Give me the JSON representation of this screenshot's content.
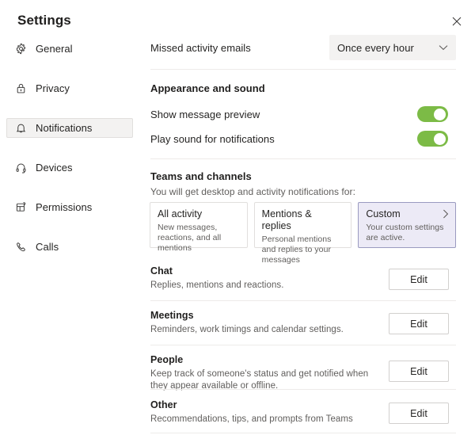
{
  "dialog": {
    "title": "Settings",
    "close_label": "Close"
  },
  "sidebar": {
    "items": [
      {
        "label": "General",
        "icon": "gear-icon",
        "selected": false
      },
      {
        "label": "Privacy",
        "icon": "lock-icon",
        "selected": false
      },
      {
        "label": "Notifications",
        "icon": "bell-icon",
        "selected": true
      },
      {
        "label": "Devices",
        "icon": "headset-icon",
        "selected": false
      },
      {
        "label": "Permissions",
        "icon": "app-grid-icon",
        "selected": false
      },
      {
        "label": "Calls",
        "icon": "phone-icon",
        "selected": false
      }
    ]
  },
  "main": {
    "missed_activity": {
      "label": "Missed activity emails",
      "dropdown_value": "Once every hour",
      "dropdown_icon": "chevron-down-icon"
    },
    "appearance": {
      "heading": "Appearance and sound",
      "toggles": [
        {
          "label": "Show message preview",
          "state": "on"
        },
        {
          "label": "Play sound for notifications",
          "state": "on"
        }
      ]
    },
    "teams_and_channels": {
      "heading": "Teams and channels",
      "subtext": "You will get desktop and activity notifications for:",
      "cards": [
        {
          "title": "All activity",
          "desc": "New messages, reactions, and all mentions",
          "selected": false,
          "chevron": ""
        },
        {
          "title": "Mentions & replies",
          "desc": "Personal mentions and replies to your messages",
          "selected": false,
          "chevron": ""
        },
        {
          "title": "Custom",
          "desc": "Your custom settings are active.",
          "selected": true,
          "chevron": "chevron-right-icon"
        }
      ]
    },
    "edit_sections": [
      {
        "title": "Chat",
        "desc": "Replies, mentions and reactions.",
        "button": "Edit"
      },
      {
        "title": "Meetings",
        "desc": "Reminders, work timings and calendar settings.",
        "button": "Edit"
      },
      {
        "title": "People",
        "desc": "Keep track of someone's status and get notified when they appear available or offline.",
        "button": "Edit"
      },
      {
        "title": "Other",
        "desc": "Recommendations, tips, and prompts from Teams",
        "button": "Edit"
      }
    ]
  },
  "colors": {
    "toggle_on": "#7cbb46",
    "selected_card_bg": "#eceaf6",
    "selected_card_border": "#9a9ac0",
    "selected_nav_bg": "#f3f2f1",
    "divider": "#edebe9",
    "dropdown_bg": "#f3f2f1"
  }
}
